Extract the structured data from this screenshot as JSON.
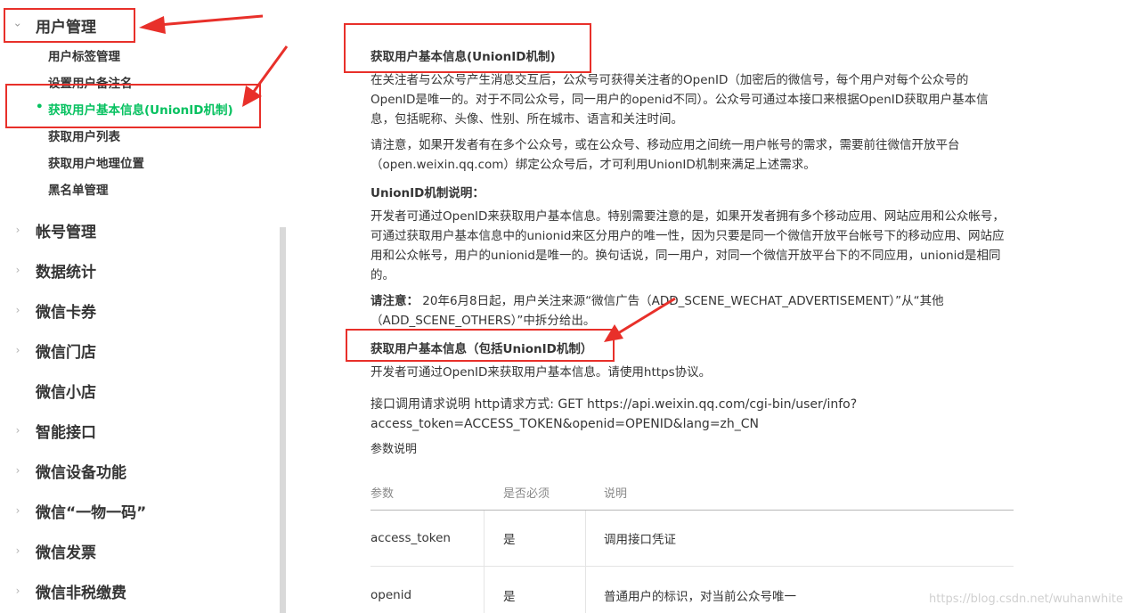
{
  "sidebar": {
    "user_mgmt": {
      "label": "用户管理",
      "items": [
        {
          "label": "用户标签管理"
        },
        {
          "label": "设置用户备注名"
        },
        {
          "label": "获取用户基本信息(UnionID机制)"
        },
        {
          "label": "获取用户列表"
        },
        {
          "label": "获取用户地理位置"
        },
        {
          "label": "黑名单管理"
        }
      ]
    },
    "sections": [
      {
        "label": "帐号管理"
      },
      {
        "label": "数据统计"
      },
      {
        "label": "微信卡券"
      },
      {
        "label": "微信门店"
      },
      {
        "label": "微信小店"
      },
      {
        "label": "智能接口"
      },
      {
        "label": "微信设备功能"
      },
      {
        "label": "微信“一物一码”"
      },
      {
        "label": "微信发票"
      },
      {
        "label": "微信非税缴费"
      }
    ]
  },
  "content": {
    "title1": "获取用户基本信息(UnionID机制)",
    "p1": "在关注者与公众号产生消息交互后，公众号可获得关注者的OpenID（加密后的微信号，每个用户对每个公众号的OpenID是唯一的。对于不同公众号，同一用户的openid不同）。公众号可通过本接口来根据OpenID获取用户基本信息，包括昵称、头像、性别、所在城市、语言和关注时间。",
    "p2": "请注意，如果开发者有在多个公众号，或在公众号、移动应用之间统一用户帐号的需求，需要前往微信开放平台（open.weixin.qq.com）绑定公众号后，才可利用UnionID机制来满足上述需求。",
    "unionid_heading": "UnionID机制说明：",
    "p3": "开发者可通过OpenID来获取用户基本信息。特别需要注意的是，如果开发者拥有多个移动应用、网站应用和公众帐号，可通过获取用户基本信息中的unionid来区分用户的唯一性，因为只要是同一个微信开放平台帐号下的移动应用、网站应用和公众帐号，用户的unionid是唯一的。换句话说，同一用户，对同一个微信开放平台下的不同应用，unionid是相同的。",
    "note_label": "请注意：",
    "note_text": " 20年6月8日起，用户关注来源“微信广告（ADD_SCENE_WECHAT_ADVERTISEMENT）”从“其他（ADD_SCENE_OTHERS）”中拆分给出。",
    "title2": "获取用户基本信息（包括UnionID机制）",
    "p4": "开发者可通过OpenID来获取用户基本信息。请使用https协议。",
    "p5": "接口调用请求说明 http请求方式: GET https://api.weixin.qq.com/cgi-bin/user/info?access_token=ACCESS_TOKEN&openid=OPENID&lang=zh_CN",
    "params_label": "参数说明"
  },
  "table": {
    "headers": [
      "参数",
      "是否必须",
      "说明"
    ],
    "rows": [
      [
        "access_token",
        "是",
        "调用接口凭证"
      ],
      [
        "openid",
        "是",
        "普通用户的标识，对当前公众号唯一"
      ]
    ]
  },
  "watermark": "https://blog.csdn.net/wuhanwhite",
  "colors": {
    "accent": "#07c160",
    "annotation": "#e8302a"
  }
}
